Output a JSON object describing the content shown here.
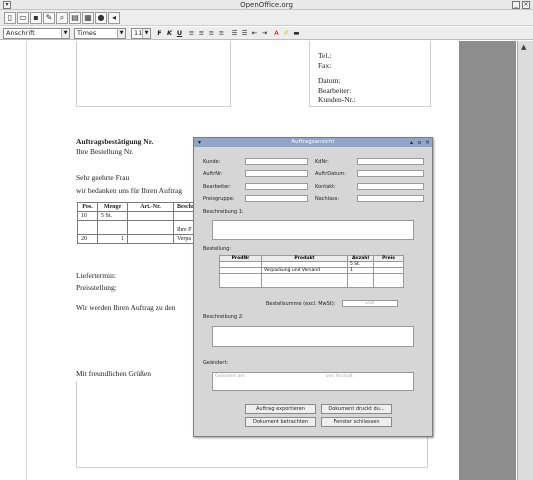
{
  "window": {
    "title": "OpenOffice.org"
  },
  "toolbar1": {
    "icons": [
      "new-doc-icon",
      "open-icon",
      "save-icon",
      "edit-icon",
      "print-icon",
      "zoom-icon",
      "table-icon",
      "record-icon",
      "nav-icon"
    ]
  },
  "toolbar2": {
    "style": "Anschrift",
    "font": "Times",
    "size": "11",
    "bold": "F",
    "italic": "K",
    "underline": "U"
  },
  "document": {
    "header_right": [
      "Tel.:",
      "Fax:",
      "",
      "Datum:",
      "Bearbeiter:",
      "Kunden-Nr.:"
    ],
    "heading": "Auftragsbestätigung Nr.",
    "order_line": "Ihre Bestellung Nr.",
    "salutation": "Sehr geehrte Frau",
    "thanks": "wir bedanken uns für Ihren Auftrag",
    "table": {
      "headers": [
        "Pos.",
        "Menge",
        "Art.-Nr.",
        "Beschr"
      ],
      "rows": [
        [
          "10",
          "5 St.",
          "",
          ""
        ],
        [
          "",
          "",
          "",
          "Ihre P"
        ],
        [
          "20",
          "1",
          "",
          "Verpa"
        ]
      ]
    },
    "delivery": "Liefertermin:",
    "pricing": "Preisstellung:",
    "processing": "Wir werden Ihren Auftrag zu den",
    "closing": "Mit freundlichen Grüßen"
  },
  "dialog": {
    "title": "Auftragsansicht",
    "labels": {
      "kunde": "Kunde:",
      "kdnr": "KdNr:",
      "auftnr": "AuftrNr:",
      "auftdatum": "AuftrDatum:",
      "bearbeiter": "Bearbeiter:",
      "kontakt": "Kontakt:",
      "preisgruppe": "Preisgruppe:",
      "nachlass": "Nachlass:",
      "beschreibung1": "Beschreibung 1:",
      "bestellung": "Bestellung:",
      "bestellsumme": "Bestellsumme (excl. MwSt):",
      "beschreibung2": "Beschreibung 2:",
      "geaendert": "Geändert:"
    },
    "order_table": {
      "headers": [
        "ProdNr",
        "Produkt",
        "Anzahl",
        "Preis"
      ],
      "rows": [
        [
          "",
          "",
          "5 St.",
          ""
        ],
        [
          "",
          "Verpackung und Versand",
          "1",
          ""
        ]
      ]
    },
    "sum_value": "EUR",
    "changed_by_placeholder": "Geändert am",
    "changed_from_placeholder": "von Anchalt",
    "buttons": {
      "export": "Auftrag exportieren",
      "print_doc": "Dokument druckt du...",
      "view_doc": "Dokument betrachten",
      "close": "Fenster schliessen"
    }
  }
}
